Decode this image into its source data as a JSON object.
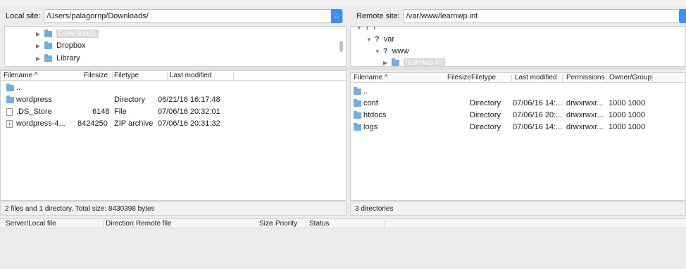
{
  "local": {
    "site_label": "Local site:",
    "path": "/Users/palagornp/Downloads/",
    "tree": [
      {
        "name": "Downloads",
        "selected": true
      },
      {
        "name": "Dropbox",
        "selected": false
      },
      {
        "name": "Library",
        "selected": false
      }
    ],
    "columns": [
      "Filename ^",
      "Filesize",
      "Filetype",
      "Last modified"
    ],
    "files": [
      {
        "name": "..",
        "size": "",
        "type": "",
        "modified": "",
        "icon": "folder-icon"
      },
      {
        "name": "wordpress",
        "size": "",
        "type": "Directory",
        "modified": "06/21/16 16:17:48",
        "icon": "folder-icon"
      },
      {
        "name": ".DS_Store",
        "size": "6148",
        "type": "File",
        "modified": "07/06/16 20:32:01",
        "icon": "file-icon"
      },
      {
        "name": "wordpress-4...",
        "size": "8424250",
        "type": "ZIP archive",
        "modified": "07/06/16 20:31:32",
        "icon": "zip-icon"
      }
    ],
    "status": "2 files and 1 directory. Total size: 8430398 bytes"
  },
  "remote": {
    "site_label": "Remote site:",
    "path": "/var/www/learnwp.int",
    "tree": [
      {
        "name": "/"
      },
      {
        "name": "var"
      },
      {
        "name": "www"
      },
      {
        "name": "learnwp.int"
      }
    ],
    "columns": [
      "Filename ^",
      "Filesize",
      "Filetype",
      "Last modified",
      "Permissions",
      "Owner/Group"
    ],
    "files": [
      {
        "name": "..",
        "type": "",
        "modified": "",
        "perms": "",
        "owner": ""
      },
      {
        "name": "conf",
        "type": "Directory",
        "modified": "07/06/16 14:...",
        "perms": "drwxrwxr...",
        "owner": "1000 1000"
      },
      {
        "name": "htdocs",
        "type": "Directory",
        "modified": "07/06/16 20:...",
        "perms": "drwxrwxr...",
        "owner": "1000 1000"
      },
      {
        "name": "logs",
        "type": "Directory",
        "modified": "07/06/16 14:...",
        "perms": "drwxrwxr...",
        "owner": "1000 1000"
      }
    ],
    "status": "3 directories"
  },
  "queue": {
    "columns": [
      "Server/Local file",
      "Direction",
      "Remote file",
      "Size",
      "Priority",
      "Status"
    ]
  },
  "colors": {
    "accent": "#3b8ff7",
    "folder": "#6faee9"
  }
}
